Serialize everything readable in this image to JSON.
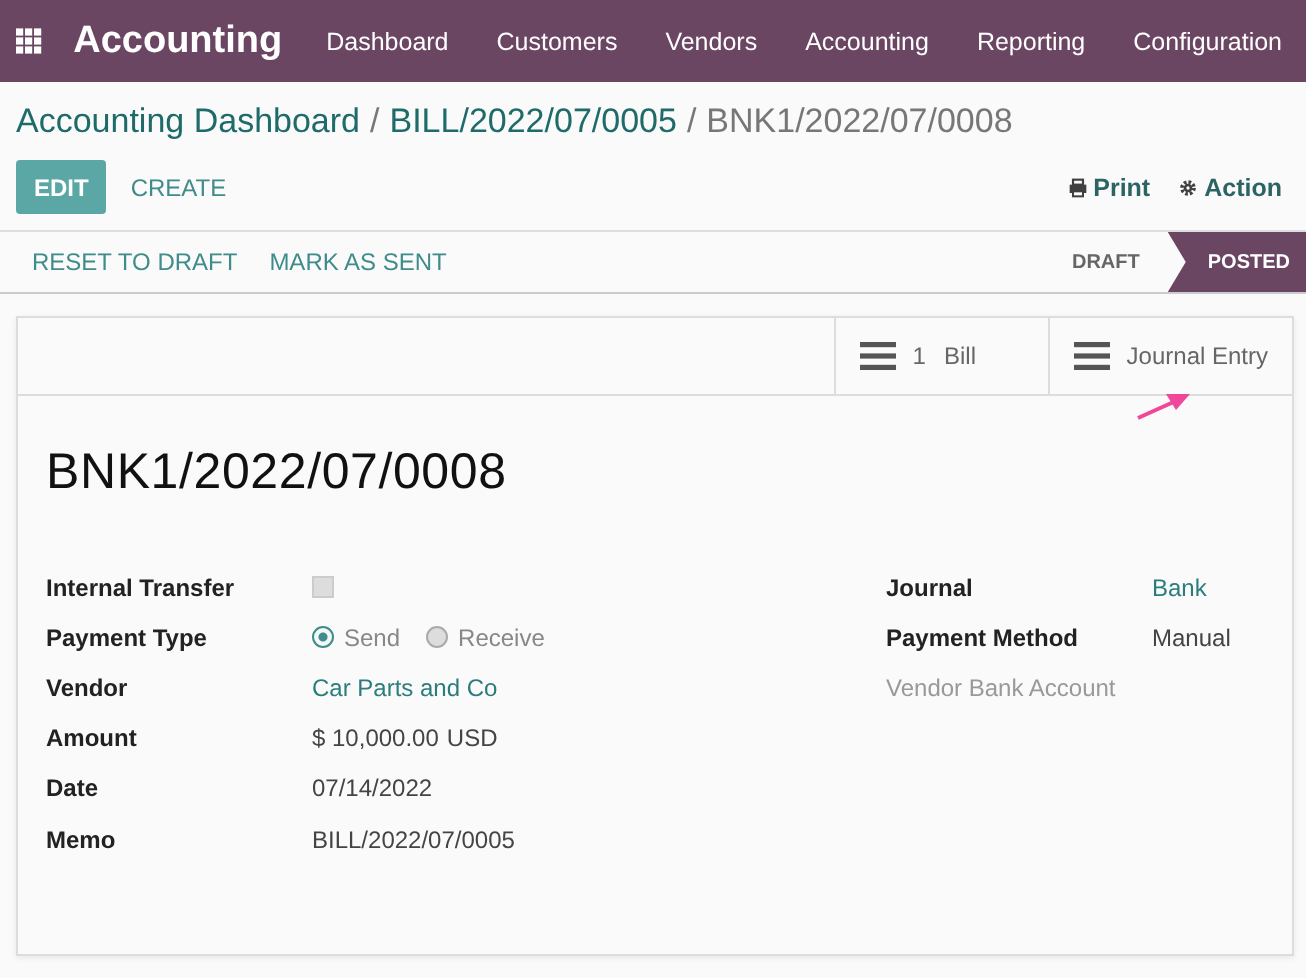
{
  "navbar": {
    "app_title": "Accounting",
    "menu": [
      "Dashboard",
      "Customers",
      "Vendors",
      "Accounting",
      "Reporting",
      "Configuration"
    ]
  },
  "breadcrumb": [
    {
      "label": "Accounting Dashboard",
      "link": true
    },
    {
      "separator": "/",
      "label": "BILL/2022/07/0005",
      "link": true
    },
    {
      "separator": "/",
      "label": "BNK1/2022/07/0008",
      "link": false
    }
  ],
  "control_panel": {
    "edit": "EDIT",
    "create": "CREATE",
    "print": "Print",
    "action": "Action"
  },
  "status_bar": {
    "buttons": [
      "RESET TO DRAFT",
      "MARK AS SENT"
    ],
    "stages": [
      {
        "label": "DRAFT",
        "selected": false
      },
      {
        "label": "POSTED",
        "selected": true
      }
    ]
  },
  "smart_buttons": [
    {
      "count": "1",
      "label": "Bill"
    },
    {
      "label": "Journal Entry"
    }
  ],
  "record_title": "BNK1/2022/07/0008",
  "left_fields": [
    {
      "label": "Internal Transfer",
      "kind": "checkbox",
      "checked": false
    },
    {
      "label": "Payment Type",
      "kind": "radio",
      "options": [
        {
          "label": "Send",
          "selected": true
        },
        {
          "label": "Receive",
          "selected": false
        }
      ]
    },
    {
      "label": "Vendor",
      "kind": "link",
      "value": "Car Parts and Co"
    },
    {
      "label": "Amount",
      "kind": "money",
      "value": "$ 10,000.00",
      "currency": "USD"
    },
    {
      "label": "Date",
      "kind": "text",
      "value": "07/14/2022"
    },
    {
      "label": "Memo",
      "kind": "text",
      "value": "BILL/2022/07/0005"
    }
  ],
  "right_fields": [
    {
      "label": "Journal",
      "kind": "link",
      "value": "Bank"
    },
    {
      "label": "Payment Method",
      "kind": "text",
      "value": "Manual"
    },
    {
      "label": "Vendor Bank Account",
      "kind": "empty"
    }
  ]
}
